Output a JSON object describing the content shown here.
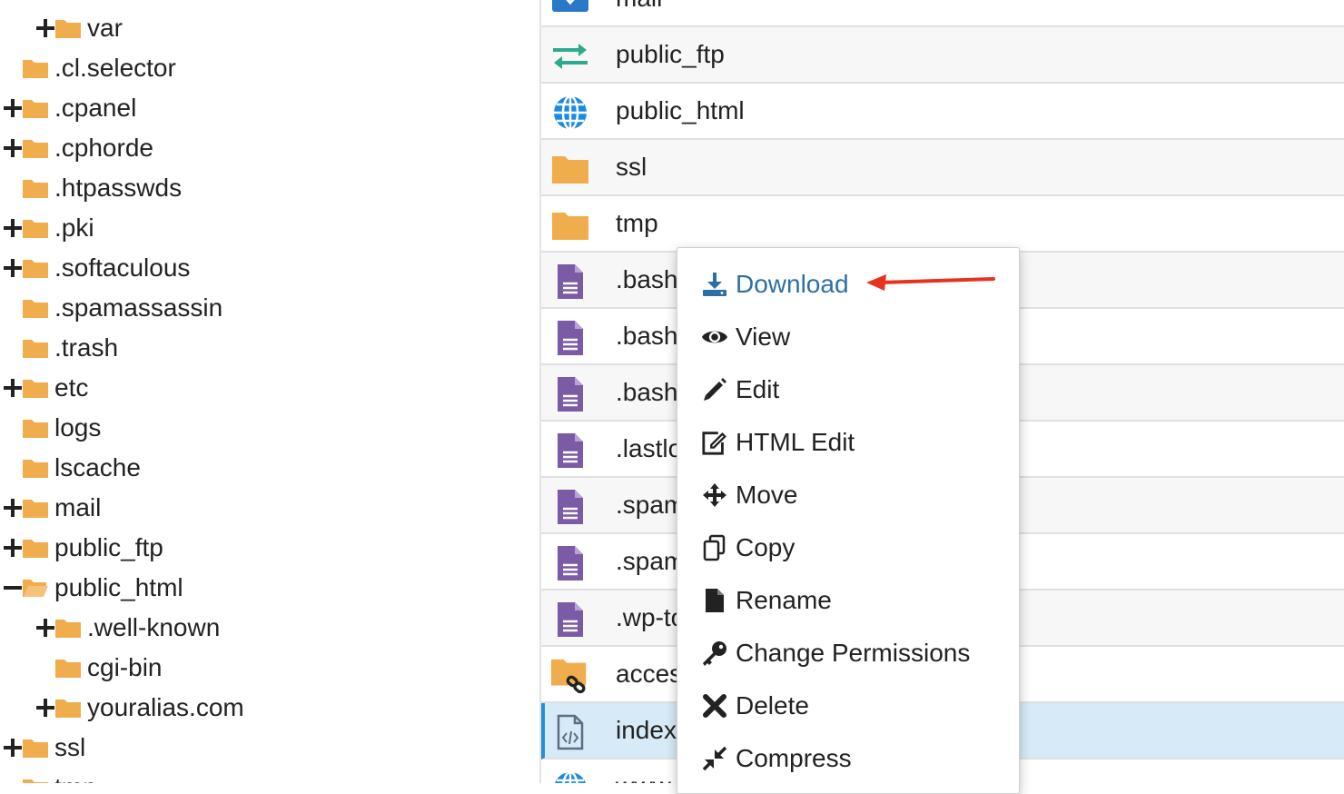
{
  "tree": {
    "items": [
      {
        "label": "var",
        "expander": "plus",
        "indent": 2
      },
      {
        "label": ".cl.selector",
        "expander": "none",
        "indent": 1
      },
      {
        "label": ".cpanel",
        "expander": "plus",
        "indent": 1
      },
      {
        "label": ".cphorde",
        "expander": "plus",
        "indent": 1
      },
      {
        "label": ".htpasswds",
        "expander": "none",
        "indent": 1
      },
      {
        "label": ".pki",
        "expander": "plus",
        "indent": 1
      },
      {
        "label": ".softaculous",
        "expander": "plus",
        "indent": 1
      },
      {
        "label": ".spamassassin",
        "expander": "none",
        "indent": 1
      },
      {
        "label": ".trash",
        "expander": "none",
        "indent": 1
      },
      {
        "label": "etc",
        "expander": "plus",
        "indent": 1
      },
      {
        "label": "logs",
        "expander": "none",
        "indent": 1
      },
      {
        "label": "lscache",
        "expander": "none",
        "indent": 1
      },
      {
        "label": "mail",
        "expander": "plus",
        "indent": 1
      },
      {
        "label": "public_ftp",
        "expander": "plus",
        "indent": 1
      },
      {
        "label": "public_html",
        "expander": "minus",
        "indent": 1,
        "open": true
      },
      {
        "label": ".well-known",
        "expander": "plus",
        "indent": 2
      },
      {
        "label": "cgi-bin",
        "expander": "none",
        "indent": 2
      },
      {
        "label": "youralias.com",
        "expander": "plus",
        "indent": 2
      },
      {
        "label": "ssl",
        "expander": "plus",
        "indent": 1
      },
      {
        "label": "tmp",
        "expander": "none",
        "indent": 1
      }
    ]
  },
  "list": {
    "rows": [
      {
        "name": "mail",
        "icon": "mail-folder-icon"
      },
      {
        "name": "public_ftp",
        "icon": "transfer-icon"
      },
      {
        "name": "public_html",
        "icon": "globe-icon"
      },
      {
        "name": "ssl",
        "icon": "folder-icon"
      },
      {
        "name": "tmp",
        "icon": "folder-icon"
      },
      {
        "name": ".bash",
        "icon": "file-text-icon"
      },
      {
        "name": ".bash",
        "icon": "file-text-icon"
      },
      {
        "name": ".bash",
        "icon": "file-text-icon"
      },
      {
        "name": ".lastlo",
        "icon": "file-text-icon"
      },
      {
        "name": ".spam",
        "icon": "file-text-icon"
      },
      {
        "name": ".spam",
        "icon": "file-text-icon"
      },
      {
        "name": ".wp-to",
        "icon": "file-text-icon"
      },
      {
        "name": "acces",
        "icon": "folder-link-icon"
      },
      {
        "name": "index",
        "icon": "file-code-icon",
        "selected": true
      },
      {
        "name": "www",
        "icon": "globe-icon"
      }
    ]
  },
  "context_menu": {
    "items": [
      {
        "label": "Download",
        "icon": "download-icon",
        "active": true
      },
      {
        "label": "View",
        "icon": "eye-icon"
      },
      {
        "label": "Edit",
        "icon": "pencil-icon"
      },
      {
        "label": "HTML Edit",
        "icon": "edit-square-icon"
      },
      {
        "label": "Move",
        "icon": "move-icon"
      },
      {
        "label": "Copy",
        "icon": "copy-icon"
      },
      {
        "label": "Rename",
        "icon": "file-icon"
      },
      {
        "label": "Change Permissions",
        "icon": "key-icon"
      },
      {
        "label": "Delete",
        "icon": "close-icon"
      },
      {
        "label": "Compress",
        "icon": "compress-icon"
      }
    ]
  },
  "colors": {
    "folder": "#f0ad4e",
    "file": "#7b5aa6",
    "globe": "#1c8ae0",
    "transfer": "#2bab8e",
    "menu_active": "#2c6fa6",
    "annotation_arrow": "#e8321e"
  }
}
